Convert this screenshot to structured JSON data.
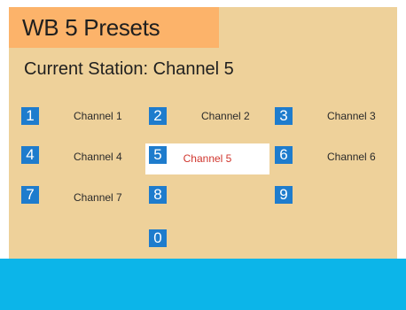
{
  "header": {
    "title": "WB 5 Presets"
  },
  "status": {
    "current_station": "Current Station: Channel 5"
  },
  "keys": {
    "k1": "1",
    "k2": "2",
    "k3": "3",
    "k4": "4",
    "k5": "5",
    "k6": "6",
    "k7": "7",
    "k8": "8",
    "k9": "9",
    "k0": "0"
  },
  "channels": {
    "c1": "Channel 1",
    "c2": "Channel 2",
    "c3": "Channel 3",
    "c4": "Channel 4",
    "c5": "Channel 5",
    "c6": "Channel 6",
    "c7": "Channel 7"
  },
  "selected_channel": "c5",
  "colors": {
    "panel": "#eed19a",
    "title_bar": "#fcb36a",
    "key": "#1e7ccd",
    "selected_text": "#d0362e",
    "footer": "#0cb5e9"
  }
}
